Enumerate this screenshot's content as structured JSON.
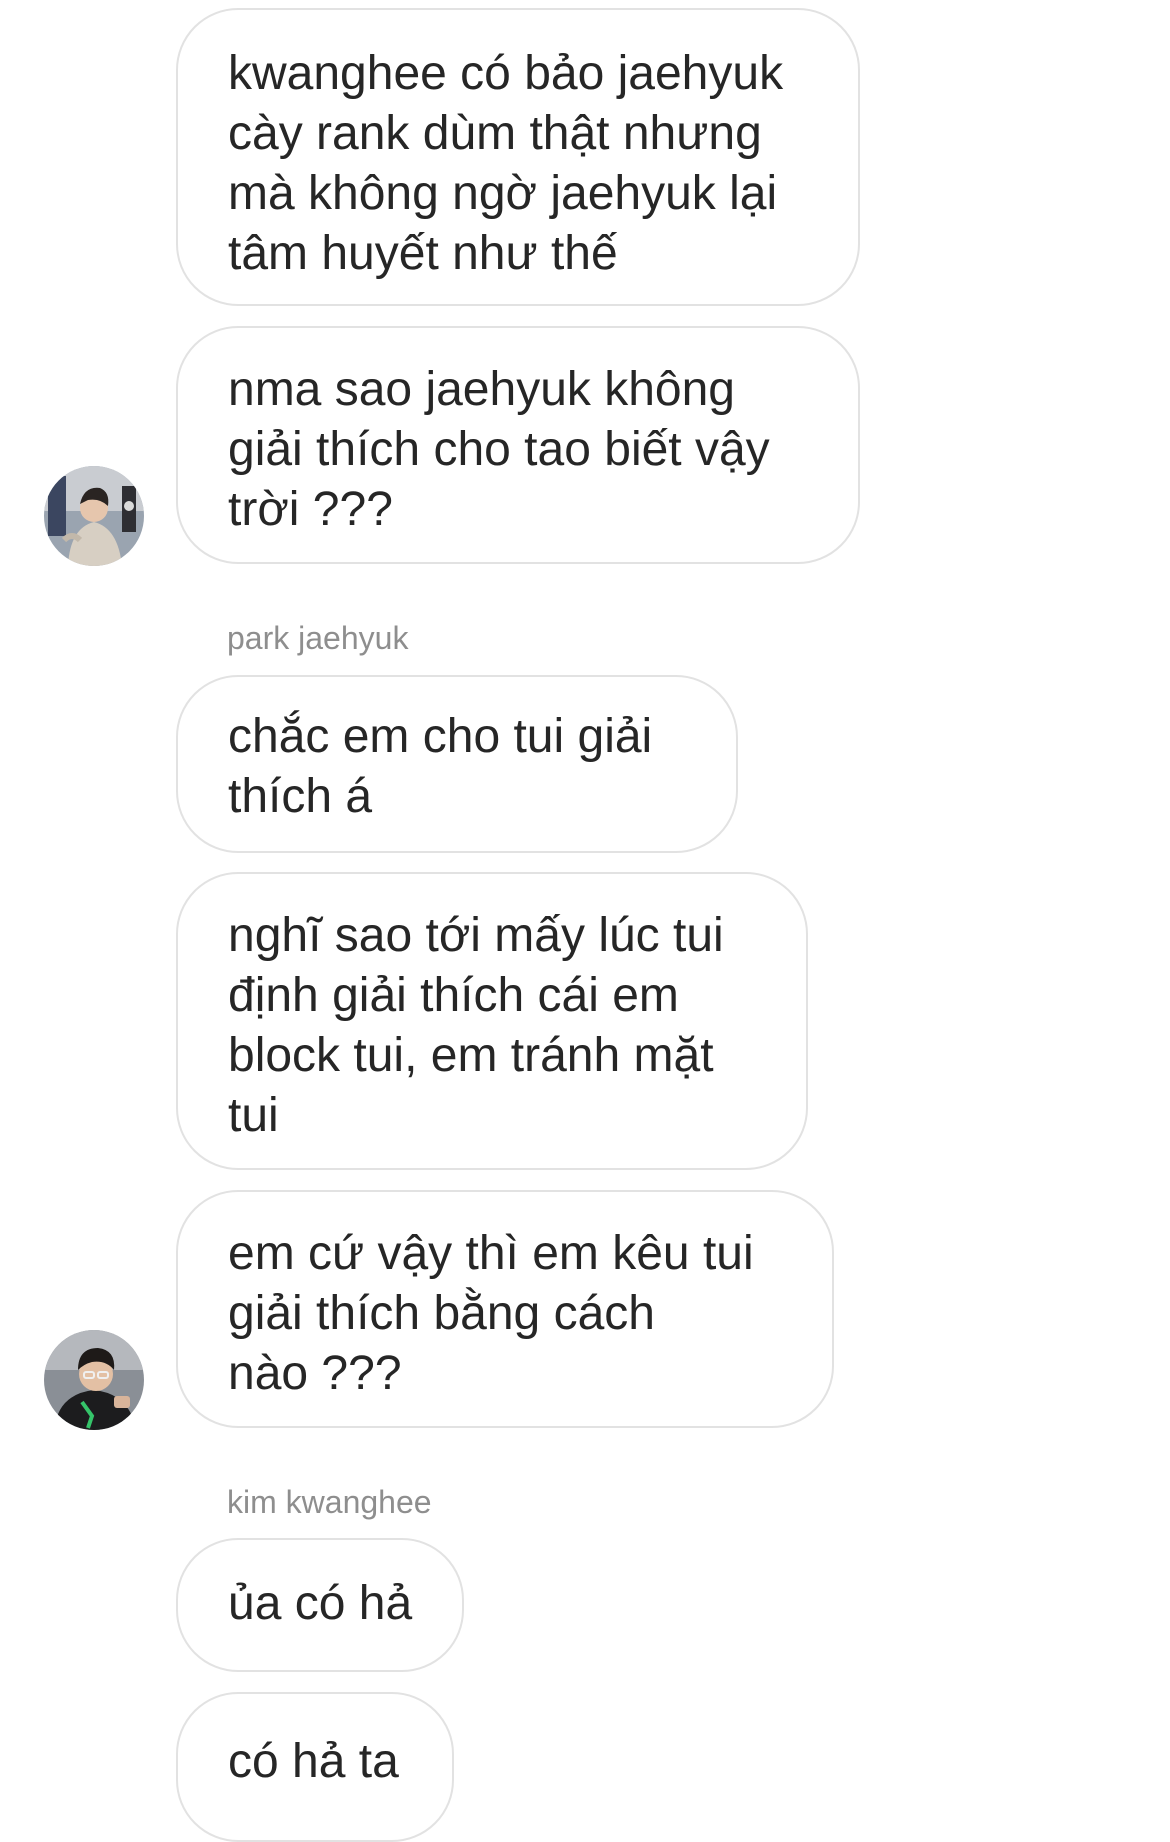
{
  "messages": [
    {
      "lines": [
        "kwanghee có bảo jaehyuk",
        "cày rank dùm thật nhưng",
        "mà không ngờ jaehyuk lại",
        "tâm huyết như thế"
      ]
    },
    {
      "lines": [
        "nma sao jaehyuk không",
        "giải thích cho tao biết vậy",
        "trời ???"
      ]
    },
    {
      "lines": [
        "chắc em cho tui giải",
        "thích á"
      ]
    },
    {
      "lines": [
        "nghĩ sao tới mấy lúc tui",
        "định giải thích cái em",
        "block tui, em tránh mặt",
        "tui"
      ]
    },
    {
      "lines": [
        "em cứ vậy thì em kêu tui",
        "giải thích bằng cách",
        "nào ???"
      ]
    },
    {
      "lines": [
        "ủa có hả"
      ]
    },
    {
      "lines": [
        "có hả ta"
      ]
    }
  ],
  "senders": {
    "jaehyuk": "park jaehyuk",
    "kwanghee": "kim kwanghee"
  },
  "avatars": {
    "first": "avatar-photo-hoodie",
    "second": "avatar-photo-glasses"
  },
  "colors": {
    "bubble_border": "#e2e2e2",
    "text": "#262626",
    "sender_label": "#8e8e8e",
    "background": "#ffffff"
  }
}
